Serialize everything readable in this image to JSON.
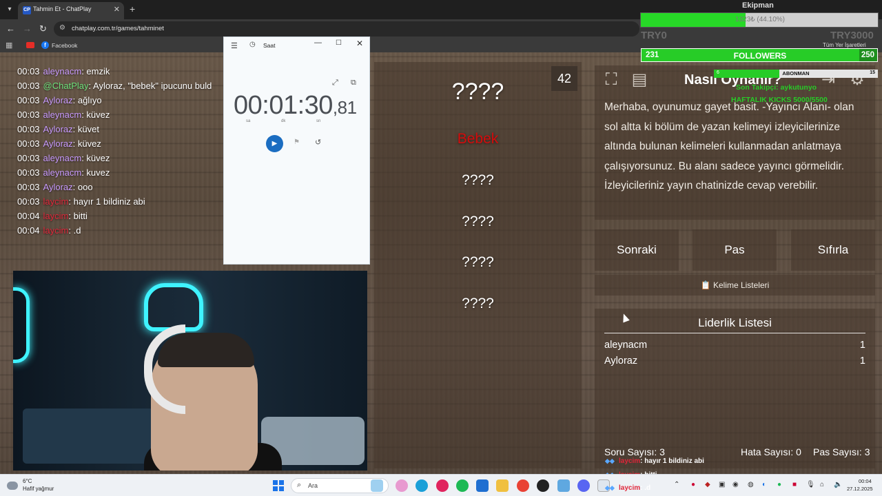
{
  "browser": {
    "tab_title": "Tahmin Et - ChatPlay",
    "tab_favicon": "CP",
    "url": "chatplay.com.tr/games/tahminet",
    "bookmark_facebook": "Facebook",
    "bookmark_all": "Tüm Yer İşaretleri"
  },
  "chat": [
    {
      "time": "00:03",
      "user": "aleynacm",
      "user_color": "#c99bff",
      "text": ": emzik"
    },
    {
      "time": "00:03",
      "user": "@ChatPlay",
      "user_color": "#6ee27c",
      "text": ": Ayloraz, \"bebek\" ipucunu buld"
    },
    {
      "time": "00:03",
      "user": "Ayloraz",
      "user_color": "#c99bff",
      "text": ": ağlıyo"
    },
    {
      "time": "00:03",
      "user": "aleynacm",
      "user_color": "#c99bff",
      "text": ": küvez"
    },
    {
      "time": "00:03",
      "user": "Ayloraz",
      "user_color": "#c99bff",
      "text": ": küvet"
    },
    {
      "time": "00:03",
      "user": "Ayloraz",
      "user_color": "#c99bff",
      "text": ": küvez"
    },
    {
      "time": "00:03",
      "user": "aleynacm",
      "user_color": "#c99bff",
      "text": ": küvez"
    },
    {
      "time": "00:03",
      "user": "aleynacm",
      "user_color": "#c99bff",
      "text": ": kuvez"
    },
    {
      "time": "00:03",
      "user": "Ayloraz",
      "user_color": "#c99bff",
      "text": ": ooo"
    },
    {
      "time": "00:03",
      "user": "laycim",
      "user_color": "#e0263a",
      "text": ": hayır 1 bildiniz abi"
    },
    {
      "time": "00:04",
      "user": "laycim",
      "user_color": "#e0263a",
      "text": ": bitti"
    },
    {
      "time": "00:04",
      "user": "laycim",
      "user_color": "#e0263a",
      "text": ": .d"
    }
  ],
  "clock_window": {
    "title": "Saat",
    "time_main": "00:01:30",
    "time_fraction": ",81",
    "unit_hours": "sa",
    "unit_minutes": "dk",
    "unit_seconds": "sn"
  },
  "game": {
    "timer": "42",
    "words": [
      "????",
      "Bebek",
      "????",
      "????",
      "????",
      "????"
    ],
    "howto_title": "Nasıl Oynanır?",
    "howto_text": "Merhaba, oyunumuz gayet basit. -Yayıncı Alanı- olan sol altta ki bölüm de yazan kelimeyi izleyicilerinize altında bulunan kelimeleri kullanmadan anlatmaya çalışıyorsunuz. Bu alanı sadece yayıncı görmelidir. İzleyicileriniz yayın chatinizde cevap verebilir.",
    "buttons": {
      "next": "Sonraki",
      "pass": "Pas",
      "reset": "Sıfırla"
    },
    "word_lists": "📋 Kelime Listeleri",
    "leaderboard_title": "Liderlik Listesi",
    "leaderboard": [
      {
        "name": "aleynacm",
        "score": "1"
      },
      {
        "name": "Ayloraz",
        "score": "1"
      }
    ],
    "stats": {
      "questions": "Soru Sayısı: 3",
      "errors": "Hata Sayısı: 0",
      "passes": "Pas Sayısı: 3"
    }
  },
  "overlay": {
    "ekipman_label": "Ekipman",
    "ekipman_text": "1323₺ (44.10%)",
    "ekipman_progress": 0.441,
    "try_left": "TRY0",
    "try_right": "TRY3000",
    "followers_current": "231",
    "followers_label": "FOLLOWERS",
    "followers_goal": "250",
    "followers_progress": 0.924,
    "abone_current": "6",
    "abone_label": "ABONMAN",
    "abone_goal": "15",
    "abone_progress": 0.4,
    "son_takipci": "Son Takipçi: aykutunyo",
    "haftalik": "HAFTALIK KICKS 5000/5500",
    "chat_lines": [
      {
        "user": "laycim",
        "text": ": hayır 1 bildiniz abi"
      },
      {
        "user": "laycim",
        "text": ": bitti"
      },
      {
        "user": "laycim",
        "text": ": .d"
      }
    ]
  },
  "taskbar": {
    "temp": "6°C",
    "weather": "Hafif yağmur",
    "search_placeholder": "Ara",
    "time": "00:04",
    "date": "27.12.2025"
  },
  "colors": {
    "accent_green": "#27cc27",
    "word_red": "#d40c0c",
    "clock_play": "#1b6dc1"
  }
}
